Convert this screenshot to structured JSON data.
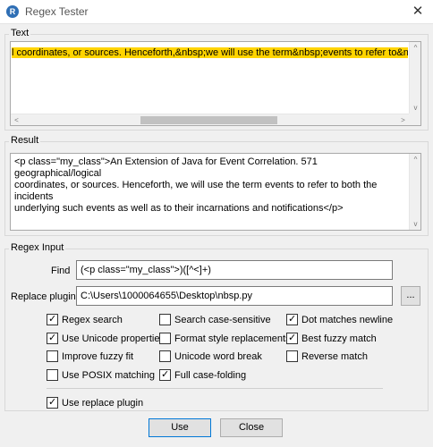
{
  "window": {
    "title": "Regex Tester",
    "close_glyph": "✕",
    "app_icon": "R"
  },
  "text_group": {
    "label": "Text",
    "content": "l coordinates, or sources. Henceforth,&nbsp;we will use the term&nbsp;events to refer to&nbsp;both the"
  },
  "result_group": {
    "label": "Result",
    "lines": [
      "<p class=\"my_class\">An Extension of Java for Event Correlation. 571 geographical/logical",
      "coordinates, or sources. Henceforth, we will use the term events to refer to both the incidents",
      "underlying such events as well as to their incarnations and notifications</p>"
    ]
  },
  "regex_group": {
    "label": "Regex Input",
    "find_label": "Find",
    "find_value": "(<p class=\"my_class\">)([^<]+)",
    "replace_label": "Replace plugin",
    "replace_value": "C:\\Users\\1000064655\\Desktop\\nbsp.py",
    "browse_label": "...",
    "options": [
      {
        "label": "Regex search",
        "checked": true
      },
      {
        "label": "Search case-sensitive",
        "checked": false
      },
      {
        "label": "Dot matches newline",
        "checked": true
      },
      {
        "label": "Use Unicode properties",
        "checked": true
      },
      {
        "label": "Format style replacements",
        "checked": false
      },
      {
        "label": "Best fuzzy match",
        "checked": true
      },
      {
        "label": "Improve fuzzy fit",
        "checked": false
      },
      {
        "label": "Unicode word break",
        "checked": false
      },
      {
        "label": "Reverse match",
        "checked": false
      },
      {
        "label": "Use POSIX matching",
        "checked": false
      },
      {
        "label": "Full case-folding",
        "checked": true
      }
    ],
    "use_plugin": {
      "label": "Use replace plugin",
      "checked": true
    }
  },
  "buttons": {
    "use": "Use",
    "close": "Close"
  },
  "scroll": {
    "left_arrow": "<",
    "right_arrow": ">",
    "up_arrow": "^",
    "down_arrow": "v"
  }
}
